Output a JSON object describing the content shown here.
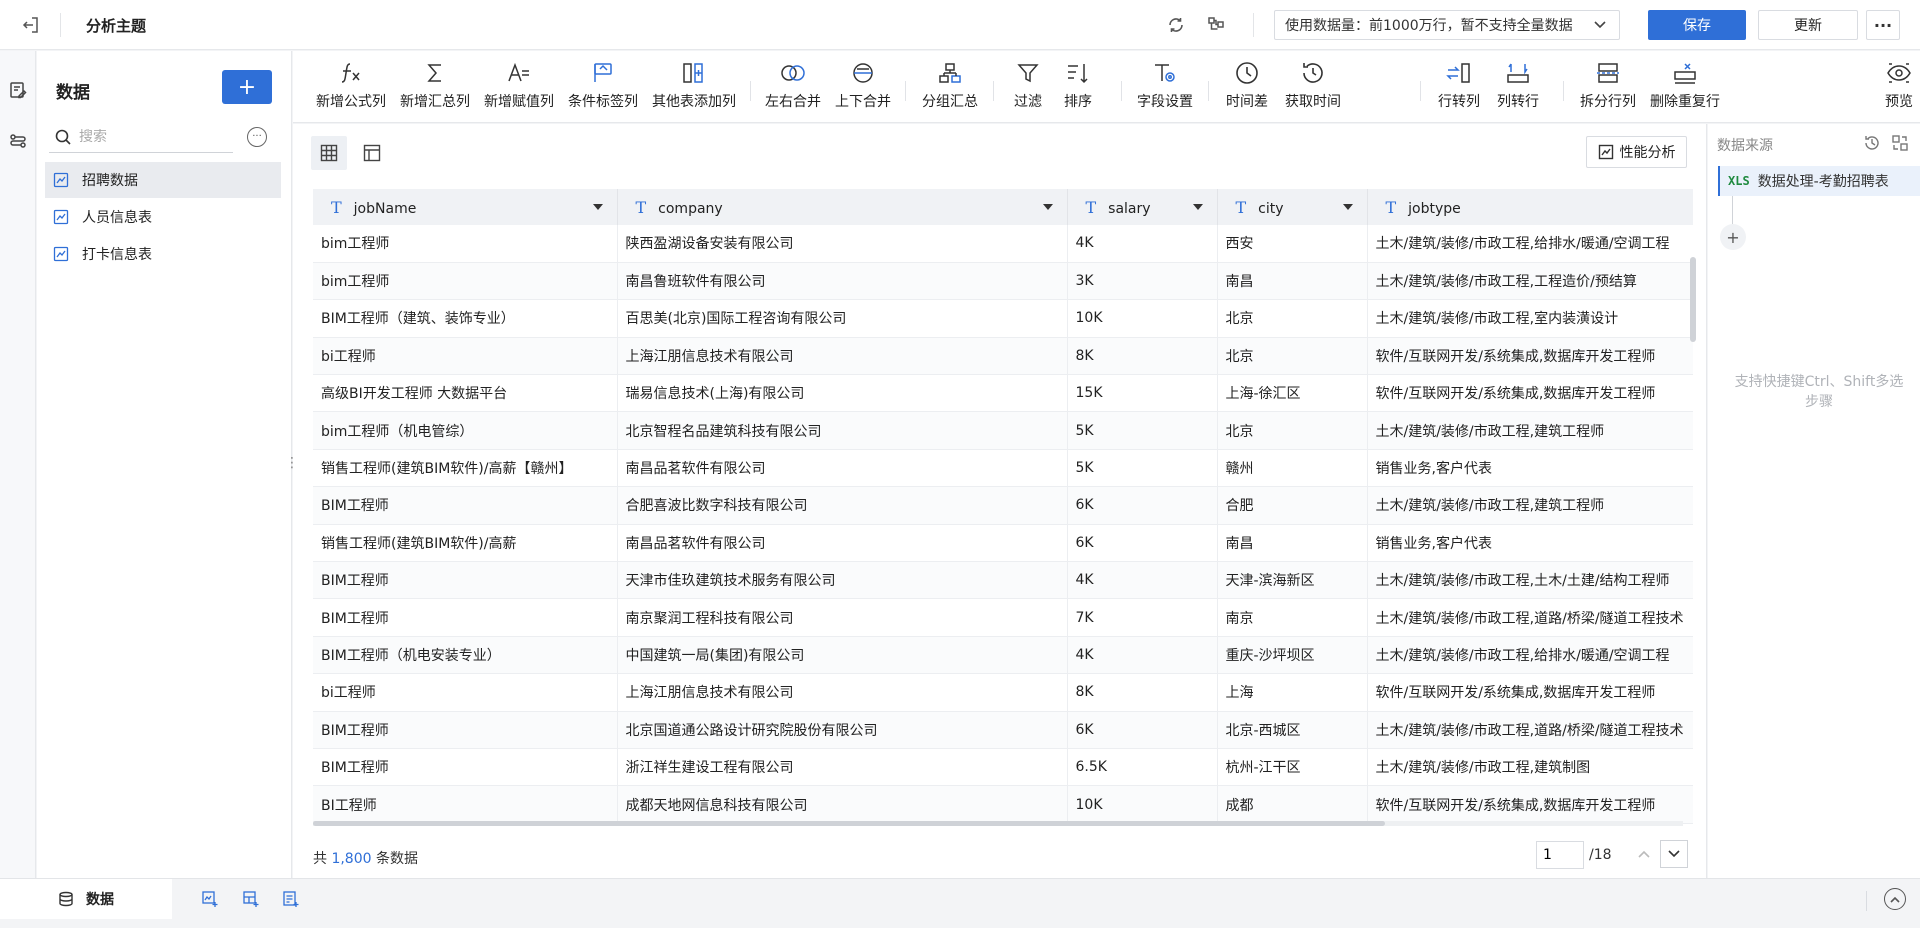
{
  "header": {
    "title": "分析主题",
    "data_volume": "使用数据量：前1000万行，暂不支持全量数据",
    "save_label": "保存",
    "update_label": "更新",
    "more_label": "···"
  },
  "sidebar": {
    "title": "数据",
    "add_label": "+",
    "search_placeholder": "搜索",
    "items": [
      {
        "label": "招聘数据",
        "active": true
      },
      {
        "label": "人员信息表",
        "active": false
      },
      {
        "label": "打卡信息表",
        "active": false
      }
    ]
  },
  "toolbar": {
    "items": [
      {
        "label": "新增公式列",
        "icon": "formula-icon"
      },
      {
        "label": "新增汇总列",
        "icon": "sigma-icon"
      },
      {
        "label": "新增赋值列",
        "icon": "assign-icon"
      },
      {
        "label": "条件标签列",
        "icon": "flag-icon"
      },
      {
        "label": "其他表添加列",
        "icon": "add-column-icon"
      },
      {
        "label": "左右合并",
        "icon": "horizontal-merge-icon"
      },
      {
        "label": "上下合并",
        "icon": "vertical-merge-icon"
      },
      {
        "label": "分组汇总",
        "icon": "group-icon"
      },
      {
        "label": "过滤",
        "icon": "filter-icon"
      },
      {
        "label": "排序",
        "icon": "sort-icon"
      },
      {
        "label": "字段设置",
        "icon": "field-settings-icon"
      },
      {
        "label": "时间差",
        "icon": "clock-icon"
      },
      {
        "label": "获取时间",
        "icon": "get-time-icon"
      },
      {
        "label": "行转列",
        "icon": "row-to-column-icon"
      },
      {
        "label": "列转行",
        "icon": "column-to-row-icon"
      },
      {
        "label": "拆分行列",
        "icon": "split-icon"
      },
      {
        "label": "删除重复行",
        "icon": "dedupe-icon"
      },
      {
        "label": "预览",
        "icon": "preview-icon"
      }
    ]
  },
  "main": {
    "perf_label": "性能分析",
    "columns": [
      "jobName",
      "company",
      "salary",
      "city",
      "jobtype"
    ],
    "rows": [
      [
        "bim工程师",
        "陕西盈湖设备安装有限公司",
        "4K",
        "西安",
        "土木/建筑/装修/市政工程,给排水/暖通/空调工程"
      ],
      [
        "bim工程师",
        "南昌鲁班软件有限公司",
        "3K",
        "南昌",
        "土木/建筑/装修/市政工程,工程造价/预结算"
      ],
      [
        "BIM工程师（建筑、装饰专业）",
        "百思美(北京)国际工程咨询有限公司",
        "10K",
        "北京",
        "土木/建筑/装修/市政工程,室内装潢设计"
      ],
      [
        "bi工程师",
        "上海江朋信息技术有限公司",
        "8K",
        "北京",
        "软件/互联网开发/系统集成,数据库开发工程师"
      ],
      [
        "高级BI开发工程师 大数据平台",
        "瑞易信息技术(上海)有限公司",
        "15K",
        "上海-徐汇区",
        "软件/互联网开发/系统集成,数据库开发工程师"
      ],
      [
        "bim工程师（机电管综）",
        "北京智程名品建筑科技有限公司",
        "5K",
        "北京",
        "土木/建筑/装修/市政工程,建筑工程师"
      ],
      [
        "销售工程师(建筑BIM软件)/高薪【赣州】",
        "南昌品茗软件有限公司",
        "5K",
        "赣州",
        "销售业务,客户代表"
      ],
      [
        "BIM工程师",
        "合肥喜波比数字科技有限公司",
        "6K",
        "合肥",
        "土木/建筑/装修/市政工程,建筑工程师"
      ],
      [
        "销售工程师(建筑BIM软件)/高薪",
        "南昌品茗软件有限公司",
        "6K",
        "南昌",
        "销售业务,客户代表"
      ],
      [
        "BIM工程师",
        "天津市佳玖建筑技术服务有限公司",
        "4K",
        "天津-滨海新区",
        "土木/建筑/装修/市政工程,土木/土建/结构工程师"
      ],
      [
        "BIM工程师",
        "南京聚润工程科技有限公司",
        "7K",
        "南京",
        "土木/建筑/装修/市政工程,道路/桥梁/隧道工程技术"
      ],
      [
        "BIM工程师（机电安装专业）",
        "中国建筑一局(集团)有限公司",
        "4K",
        "重庆-沙坪坝区",
        "土木/建筑/装修/市政工程,给排水/暖通/空调工程"
      ],
      [
        "bi工程师",
        "上海江朋信息技术有限公司",
        "8K",
        "上海",
        "软件/互联网开发/系统集成,数据库开发工程师"
      ],
      [
        "BIM工程师",
        "北京国道通公路设计研究院股份有限公司",
        "6K",
        "北京-西城区",
        "土木/建筑/装修/市政工程,道路/桥梁/隧道工程技术"
      ],
      [
        "BIM工程师",
        "浙江祥生建设工程有限公司",
        "6.5K",
        "杭州-江干区",
        "土木/建筑/装修/市政工程,建筑制图"
      ],
      [
        "BI工程师",
        "成都天地网信息科技有限公司",
        "10K",
        "成都",
        "软件/互联网开发/系统集成,数据库开发工程师"
      ]
    ],
    "footer_prefix": "共",
    "total_count": "1,800",
    "footer_suffix": "条数据",
    "page_current": "1",
    "page_total": "/18"
  },
  "right_panel": {
    "title": "数据来源",
    "step_badge": "XLS",
    "step_label": "数据处理-考勤招聘表",
    "add_label": "+",
    "hint": "支持快捷键Ctrl、Shift多选步骤"
  },
  "bottom": {
    "tab_label": "数据"
  },
  "colors": {
    "accent": "#2f6fd7",
    "excel_green": "#1f8a3f"
  }
}
